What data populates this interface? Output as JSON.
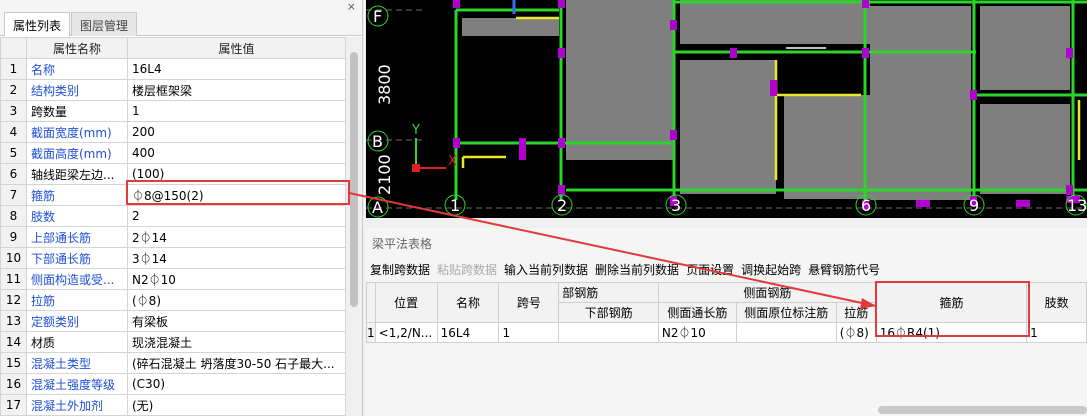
{
  "left_panel": {
    "tabs": [
      "属性列表",
      "图层管理"
    ],
    "close_glyph": "×",
    "headers": [
      "属性名称",
      "属性值"
    ],
    "rows": [
      {
        "num": "1",
        "name": "名称",
        "value": "16L4"
      },
      {
        "num": "2",
        "name": "结构类别",
        "value": "楼层框架梁"
      },
      {
        "num": "3",
        "name": "跨数量",
        "value": "1"
      },
      {
        "num": "4",
        "name": "截面宽度(mm)",
        "value": "200"
      },
      {
        "num": "5",
        "name": "截面高度(mm)",
        "value": "400"
      },
      {
        "num": "6",
        "name": "轴线距梁左边...",
        "value": "(100)"
      },
      {
        "num": "7",
        "name": "箍筋",
        "value": "⏀8@150(2)"
      },
      {
        "num": "8",
        "name": "肢数",
        "value": "2"
      },
      {
        "num": "9",
        "name": "上部通长筋",
        "value": "2⏀14"
      },
      {
        "num": "10",
        "name": "下部通长筋",
        "value": "3⏀14"
      },
      {
        "num": "11",
        "name": "侧面构造或受...",
        "value": "N2⏀10"
      },
      {
        "num": "12",
        "name": "拉筋",
        "value": "(⏀8)"
      },
      {
        "num": "13",
        "name": "定额类别",
        "value": "有梁板"
      },
      {
        "num": "14",
        "name": "材质",
        "value": "现浇混凝土"
      },
      {
        "num": "15",
        "name": "混凝土类型",
        "value": "(碎石混凝土 坍落度30-50 石子最大..."
      },
      {
        "num": "16",
        "name": "混凝土强度等级",
        "value": "(C30)"
      },
      {
        "num": "17",
        "name": "混凝土外加剂",
        "value": "(无)"
      }
    ]
  },
  "cad": {
    "axis_labels": {
      "F": "F",
      "B": "B",
      "A": "A"
    },
    "dims": [
      "3800",
      "2100"
    ],
    "col_labels": [
      "1",
      "2",
      "3",
      "6",
      "9",
      "13"
    ],
    "ucs_x": "X",
    "ucs_y": "Y"
  },
  "bottom_panel": {
    "title": "梁平法表格",
    "toolbar": [
      {
        "label": "复制跨数据",
        "enabled": true
      },
      {
        "label": "粘贴跨数据",
        "enabled": false
      },
      {
        "label": "输入当前列数据",
        "enabled": true
      },
      {
        "label": "删除当前列数据",
        "enabled": true
      },
      {
        "label": "页面设置",
        "enabled": true
      },
      {
        "label": "调换起始跨",
        "enabled": true
      },
      {
        "label": "悬臂钢筋代号",
        "enabled": true
      }
    ],
    "headers": {
      "position": "位置",
      "name": "名称",
      "span": "跨号",
      "bottom_rebar_group": "部钢筋",
      "bottom_rebar": "下部钢筋",
      "side_rebar_group": "侧面钢筋",
      "side_long": "侧面通长筋",
      "side_orig": "侧面原位标注筋",
      "tie": "拉筋",
      "stirrup": "箍筋",
      "legs": "肢数"
    },
    "row": {
      "num": "1",
      "position": "<1,2/N...",
      "name": "16L4",
      "span": "1",
      "bottom_rebar": "",
      "side_long": "N2⏀10",
      "side_orig": "",
      "tie": "(⏀8)",
      "stirrup": "16⏀R4(1)",
      "legs": "1"
    }
  }
}
